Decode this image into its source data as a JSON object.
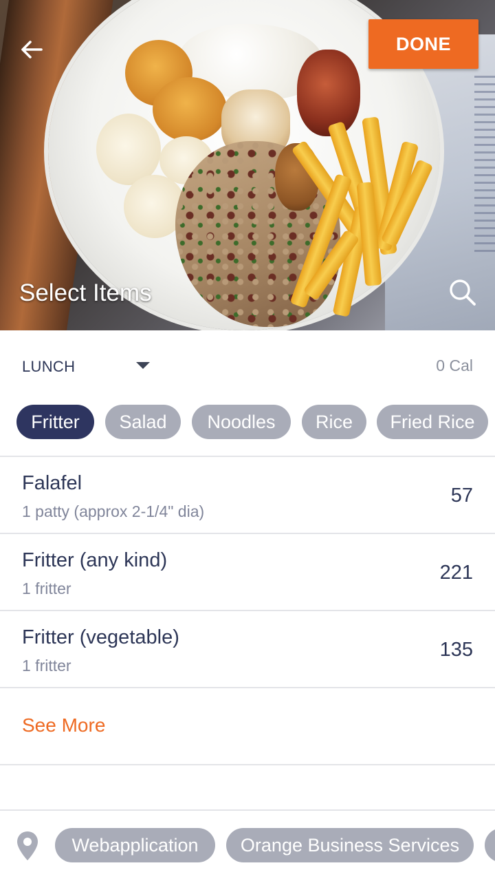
{
  "header": {
    "back_icon": "arrow-left-icon",
    "done_label": "DONE",
    "title": "Select Items",
    "search_icon": "search-icon",
    "accent_color": "#ee6a22"
  },
  "meal": {
    "selected": "LUNCH",
    "calories": "0 Cal"
  },
  "categories": [
    {
      "label": "Fritter",
      "active": true
    },
    {
      "label": "Salad",
      "active": false
    },
    {
      "label": "Noodles",
      "active": false
    },
    {
      "label": "Rice",
      "active": false
    },
    {
      "label": "Fried Rice",
      "active": false
    }
  ],
  "foods": [
    {
      "name": "Falafel",
      "serving": "1 patty (approx 2-1/4\" dia)",
      "calories": "57"
    },
    {
      "name": "Fritter (any kind)",
      "serving": "1 fritter",
      "calories": "221"
    },
    {
      "name": "Fritter (vegetable)",
      "serving": "1 fritter",
      "calories": "135"
    }
  ],
  "see_more_label": "See More",
  "locations": {
    "pin_icon": "location-pin-icon",
    "items": [
      "Webapplication",
      "Orange Business Services"
    ]
  }
}
